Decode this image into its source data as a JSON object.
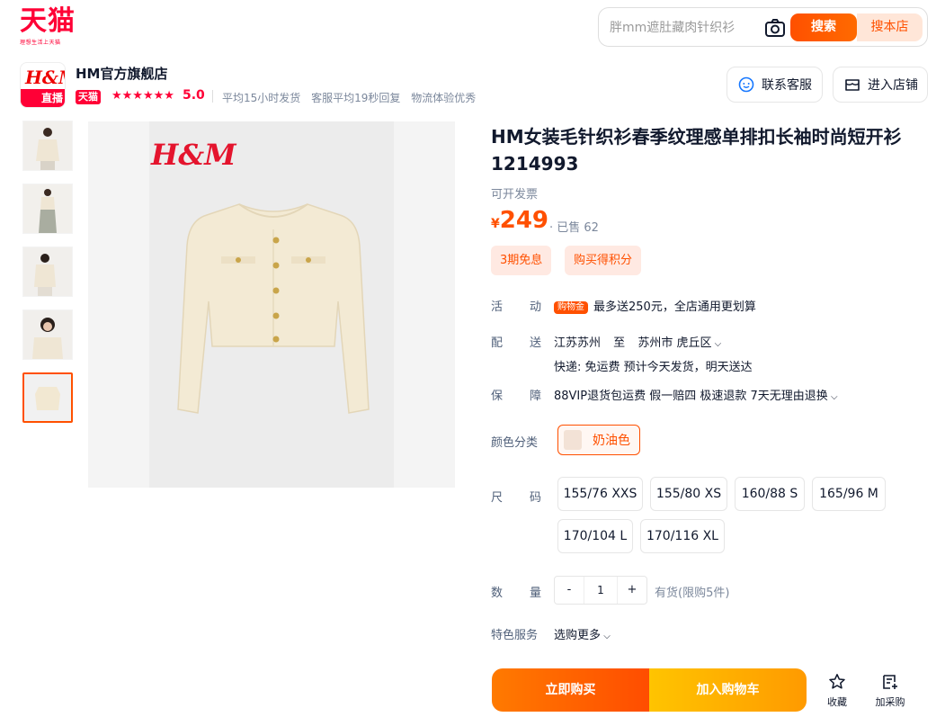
{
  "brand": {
    "logo_text": "天猫",
    "logo_sub": "理想生活上天猫"
  },
  "search": {
    "placeholder": "胖mm遮肚藏肉针织衫",
    "search_label": "搜索",
    "shop_search_label": "搜本店"
  },
  "shop": {
    "name": "HM官方旗舰店",
    "logo_text": "H&M",
    "live_label": "直播",
    "tmall_badge": "天猫",
    "stars": "★★★★★★",
    "rating": "5.0",
    "meta": [
      "平均15小时发货",
      "客服平均19秒回复",
      "物流体验优秀"
    ],
    "service_label": "联系客服",
    "enter_label": "进入店铺"
  },
  "gallery": {
    "brand_mark": "H&M",
    "active_index": 4
  },
  "product": {
    "title": "HM女装毛针织衫春季纹理感单排扣长袖时尚短开衫1214993",
    "invoice": "可开发票",
    "currency": "¥",
    "price": "249",
    "sold": "· 已售 62",
    "chips": [
      "3期免息",
      "购买得积分"
    ]
  },
  "promo": {
    "label_a": "活",
    "label_b": "动",
    "badge": "购物金",
    "text": "最多送250元，全店通用更划算"
  },
  "delivery": {
    "label_a": "配",
    "label_b": "送",
    "from": "江苏苏州",
    "to_word": "至",
    "dest": "苏州市 虎丘区",
    "detail": "快递: 免运费   预计今天发货，明天送达"
  },
  "guarantee": {
    "label_a": "保",
    "label_b": "障",
    "text": "88VIP退货包运费 假一赔四 极速退款 7天无理由退换"
  },
  "color": {
    "label": "颜色分类",
    "option": "奶油色"
  },
  "size": {
    "label_a": "尺",
    "label_b": "码",
    "options": [
      "155/76 XXS",
      "155/80 XS",
      "160/88 S",
      "165/96 M",
      "170/104 L",
      "170/116 XL"
    ]
  },
  "quantity": {
    "label_a": "数",
    "label_b": "量",
    "minus": "-",
    "value": "1",
    "plus": "+",
    "stock": "有货(限购5件)"
  },
  "special": {
    "label": "特色服务",
    "value": "选购更多"
  },
  "actions": {
    "buy": "立即购买",
    "cart": "加入购物车",
    "favorite": "收藏",
    "add_list": "加采购"
  },
  "colors": {
    "accent": "#ff5000",
    "tmall_red": "#ff0036"
  }
}
